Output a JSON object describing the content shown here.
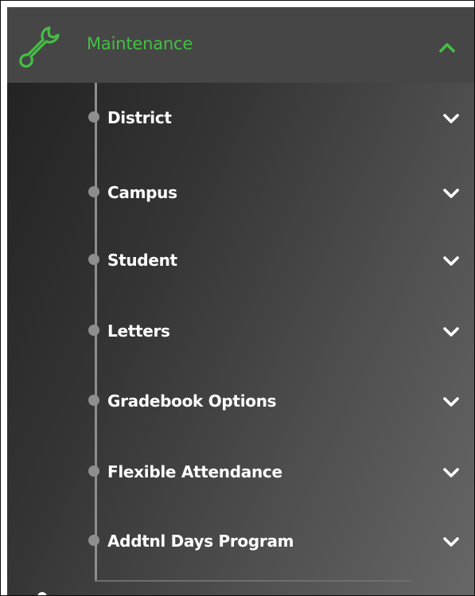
{
  "menu": {
    "header": {
      "title": "Maintenance",
      "icon": "wrench-icon",
      "expanded": true,
      "accent_color": "#43c043"
    },
    "items": [
      {
        "label": "District"
      },
      {
        "label": "Campus"
      },
      {
        "label": "Student"
      },
      {
        "label": "Letters"
      },
      {
        "label": "Gradebook Options"
      },
      {
        "label": "Flexible Attendance"
      },
      {
        "label": "Addtnl Days Program"
      }
    ]
  }
}
